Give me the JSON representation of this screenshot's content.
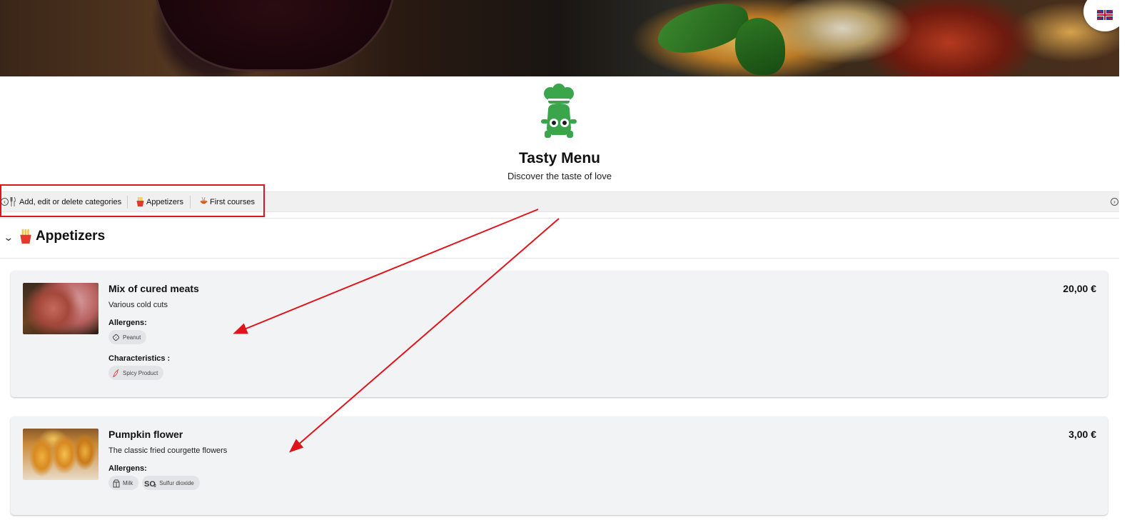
{
  "app": {
    "title": "Tasty Menu",
    "subtitle": "Discover the taste of love",
    "language_icon": "uk-flag-icon"
  },
  "category_bar": {
    "items": [
      {
        "label": "Add, edit or delete categories",
        "icon": "fork-knife-icon"
      },
      {
        "label": "Appetizers",
        "icon": "fries-icon"
      },
      {
        "label": "First courses",
        "icon": "pasta-bowl-icon"
      }
    ]
  },
  "section": {
    "title": "Appetizers",
    "icon": "fries-icon"
  },
  "dishes": [
    {
      "name": "Mix of cured meats",
      "description": "Various cold cuts",
      "price": "20,00 €",
      "allergens_label": "Allergens:",
      "allergens": [
        {
          "label": "Peanut",
          "icon": "peanut-icon"
        }
      ],
      "characteristics_label": "Characteristics :",
      "characteristics": [
        {
          "label": "Spicy Product",
          "icon": "chili-pepper-icon"
        }
      ]
    },
    {
      "name": "Pumpkin flower",
      "description": "The classic fried courgette flowers",
      "price": "3,00 €",
      "allergens_label": "Allergens:",
      "allergens": [
        {
          "label": "Milk",
          "icon": "milk-carton-icon"
        },
        {
          "label": "Sulfur dioxide",
          "icon": "so2-icon"
        }
      ]
    }
  ],
  "colors": {
    "annotation_red": "#e0141b",
    "logo_green": "#3aa54a",
    "card_bg": "#f2f3f5"
  }
}
